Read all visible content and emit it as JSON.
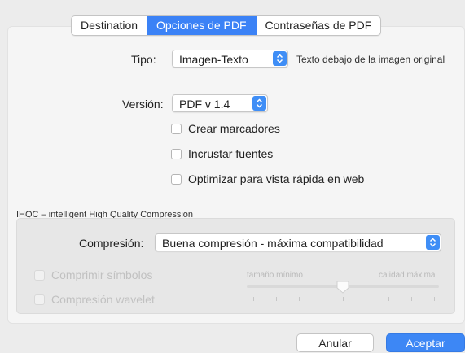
{
  "tabs": [
    {
      "label": "Destination"
    },
    {
      "label": "Opciones de PDF",
      "active": true
    },
    {
      "label": "Contraseñas de PDF"
    }
  ],
  "tipo": {
    "label": "Tipo:",
    "value": "Imagen-Texto",
    "hint": "Texto debajo de la imagen original"
  },
  "version": {
    "label": "Versión:",
    "value": "PDF v 1.4"
  },
  "checkboxes": [
    {
      "label": "Crear marcadores",
      "checked": false
    },
    {
      "label": "Incrustar fuentes",
      "checked": false
    },
    {
      "label": "Optimizar para vista rápida en web",
      "checked": false
    }
  ],
  "ihqc": {
    "title": "IHQC – intelligent High Quality Compression",
    "compression_label": "Compresión:",
    "compression_value": "Buena compresión - máxima compatibilidad",
    "symbols_label": "Comprimir símbolos",
    "wavelet_label": "Compresión wavelet",
    "slider_min_label": "tamaño mínimo",
    "slider_max_label": "calidad máxima",
    "slider_value": 0.5,
    "enabled": false
  },
  "buttons": {
    "cancel": "Anular",
    "ok": "Aceptar"
  },
  "colors": {
    "accent": "#3b82f6",
    "background": "#ececec",
    "disabled_text": "#c1c1c1"
  }
}
